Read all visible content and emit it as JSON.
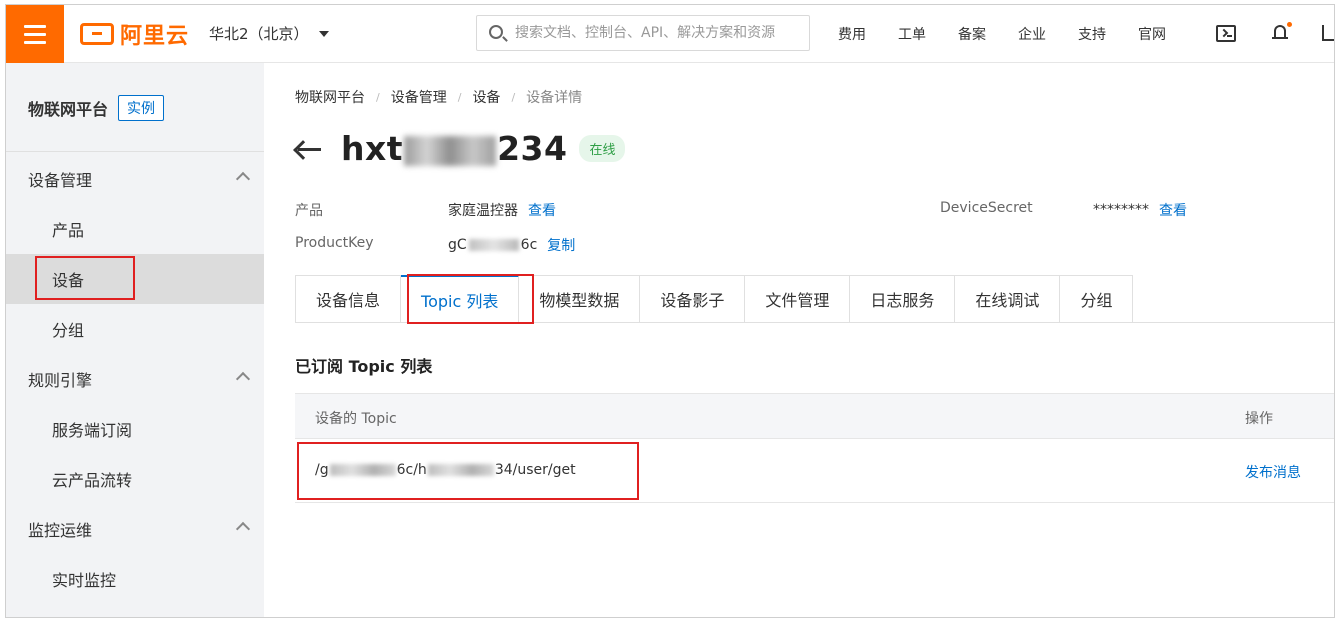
{
  "topbar": {
    "logo_text": "阿里云",
    "region": "华北2（北京）",
    "search_placeholder": "搜索文档、控制台、API、解决方案和资源",
    "nav": [
      "费用",
      "工单",
      "备案",
      "企业",
      "支持",
      "官网"
    ]
  },
  "sidebar": {
    "title": "物联网平台",
    "badge": "实例",
    "groups": [
      {
        "label": "设备管理",
        "items": [
          "产品",
          "设备",
          "分组"
        ]
      },
      {
        "label": "规则引擎",
        "items": [
          "服务端订阅",
          "云产品流转"
        ]
      },
      {
        "label": "监控运维",
        "items": [
          "实时监控"
        ]
      }
    ],
    "active_item": "设备"
  },
  "breadcrumb": [
    "物联网平台",
    "设备管理",
    "设备",
    "设备详情"
  ],
  "device": {
    "name_prefix": "hxt",
    "name_suffix": "234",
    "status": "在线",
    "product_label": "产品",
    "product_value": "家庭温控器",
    "product_link": "查看",
    "secret_label": "DeviceSecret",
    "secret_value": "********",
    "secret_link": "查看",
    "productkey_label": "ProductKey",
    "productkey_prefix": "gC",
    "productkey_suffix": "6c",
    "productkey_link": "复制"
  },
  "tabs": [
    "设备信息",
    "Topic 列表",
    "物模型数据",
    "设备影子",
    "文件管理",
    "日志服务",
    "在线调试",
    "分组"
  ],
  "active_tab": "Topic 列表",
  "section_title": "已订阅 Topic 列表",
  "table": {
    "col_topic": "设备的 Topic",
    "col_action": "操作",
    "rows": [
      {
        "topic_prefix": "/g",
        "topic_mid": "6c/h",
        "topic_suffix": "34/user/get",
        "action": "发布消息"
      }
    ]
  }
}
